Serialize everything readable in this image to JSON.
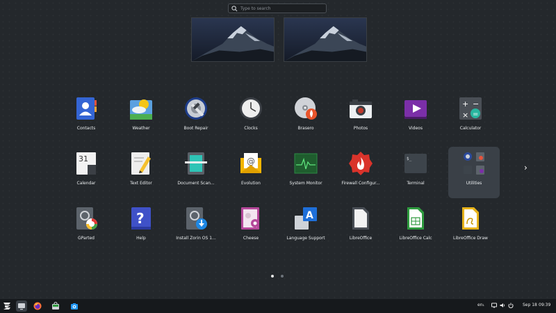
{
  "search": {
    "placeholder": "Type to search"
  },
  "workspaces": [
    {
      "name": "workspace-1"
    },
    {
      "name": "workspace-2"
    }
  ],
  "apps": [
    {
      "label": "Contacts",
      "icon": "contacts-icon"
    },
    {
      "label": "Weather",
      "icon": "weather-icon"
    },
    {
      "label": "Boot Repair",
      "icon": "boot-repair-icon"
    },
    {
      "label": "Clocks",
      "icon": "clocks-icon"
    },
    {
      "label": "Brasero",
      "icon": "brasero-icon"
    },
    {
      "label": "Photos",
      "icon": "photos-icon"
    },
    {
      "label": "Videos",
      "icon": "videos-icon"
    },
    {
      "label": "Calculator",
      "icon": "calculator-icon"
    },
    {
      "label": "Calendar",
      "icon": "calendar-icon",
      "day": "31"
    },
    {
      "label": "Text Editor",
      "icon": "text-editor-icon"
    },
    {
      "label": "Document Scan...",
      "icon": "document-scanner-icon"
    },
    {
      "label": "Evolution",
      "icon": "evolution-icon"
    },
    {
      "label": "System Monitor",
      "icon": "system-monitor-icon"
    },
    {
      "label": "Firewall Configur...",
      "icon": "firewall-icon"
    },
    {
      "label": "Terminal",
      "icon": "terminal-icon",
      "prompt": "$_"
    },
    {
      "label": "Utilities",
      "icon": "utilities-folder-icon"
    },
    {
      "label": "GParted",
      "icon": "gparted-icon"
    },
    {
      "label": "Help",
      "icon": "help-icon",
      "glyph": "?"
    },
    {
      "label": "Install Zorin OS 1...",
      "icon": "install-icon"
    },
    {
      "label": "Cheese",
      "icon": "cheese-icon"
    },
    {
      "label": "Language Support",
      "icon": "language-support-icon",
      "glyph": "A"
    },
    {
      "label": "LibreOffice",
      "icon": "libreoffice-icon"
    },
    {
      "label": "LibreOffice Calc",
      "icon": "libreoffice-calc-icon"
    },
    {
      "label": "LibreOffice Draw",
      "icon": "libreoffice-draw-icon"
    }
  ],
  "selected_app": "Utilities",
  "pagination": {
    "pages": 2,
    "current": 1
  },
  "next_page_glyph": "›",
  "taskbar": {
    "items": [
      "zorin-menu-icon",
      "show-desktop-icon",
      "firefox-icon",
      "software-store-icon",
      "screenshot-icon"
    ],
    "keyboard_layout": "en₁",
    "date": "Sep 18",
    "time": "09:39"
  },
  "colors": {
    "background": "#24282c",
    "taskbar": "#16191c",
    "selected_tile": "#3a4047"
  }
}
